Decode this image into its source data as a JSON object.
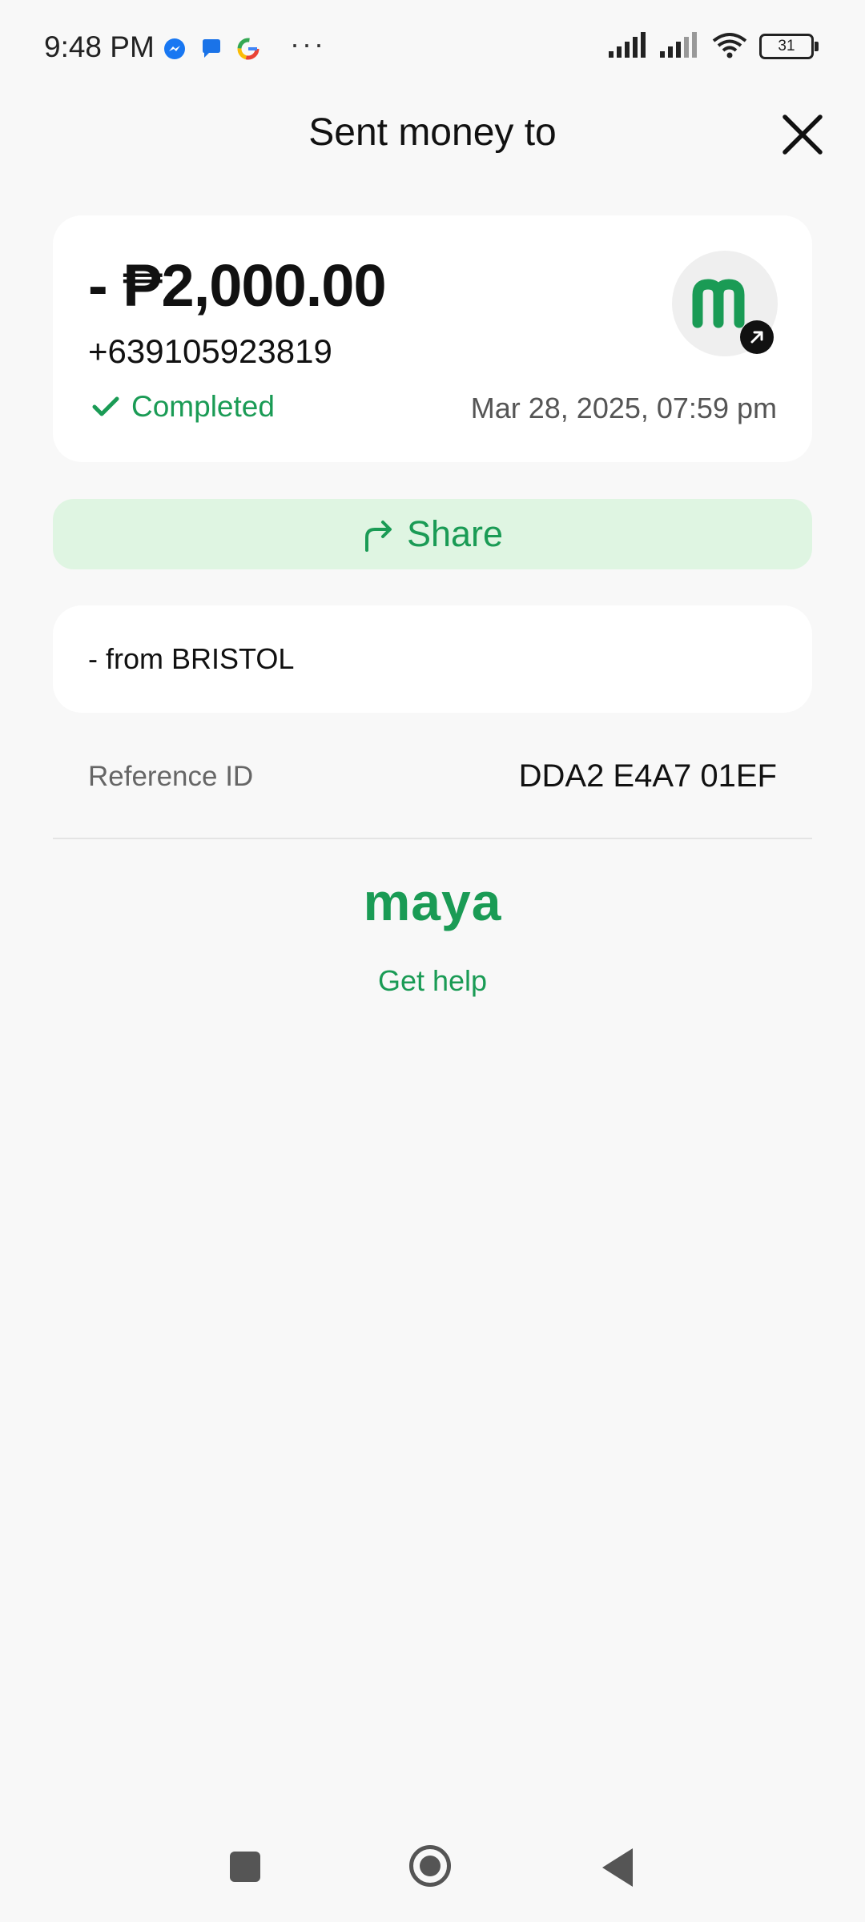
{
  "status_bar": {
    "time": "9:48 PM",
    "notification_icons": [
      "messenger-icon",
      "chat-icon",
      "google-icon"
    ],
    "more": "···",
    "battery": "31",
    "system_icons": [
      "signal-icon",
      "signal-icon",
      "wifi-icon",
      "battery-icon"
    ]
  },
  "header": {
    "title": "Sent money to",
    "close_icon": "close-icon"
  },
  "transaction": {
    "amount": "- ₱2,000.00",
    "recipient": "+639105923819",
    "status": "Completed",
    "date": "Mar 28, 2025, 07:59 pm"
  },
  "share": {
    "label": "Share"
  },
  "note": {
    "text": "- from BRISTOL"
  },
  "reference": {
    "label": "Reference ID",
    "value": "DDA2 E4A7 01EF"
  },
  "footer": {
    "logo": "maya",
    "help": "Get help"
  },
  "colors": {
    "accent": "#1a9b55",
    "share_bg": "#dff5e2",
    "background": "#f8f8f8"
  }
}
